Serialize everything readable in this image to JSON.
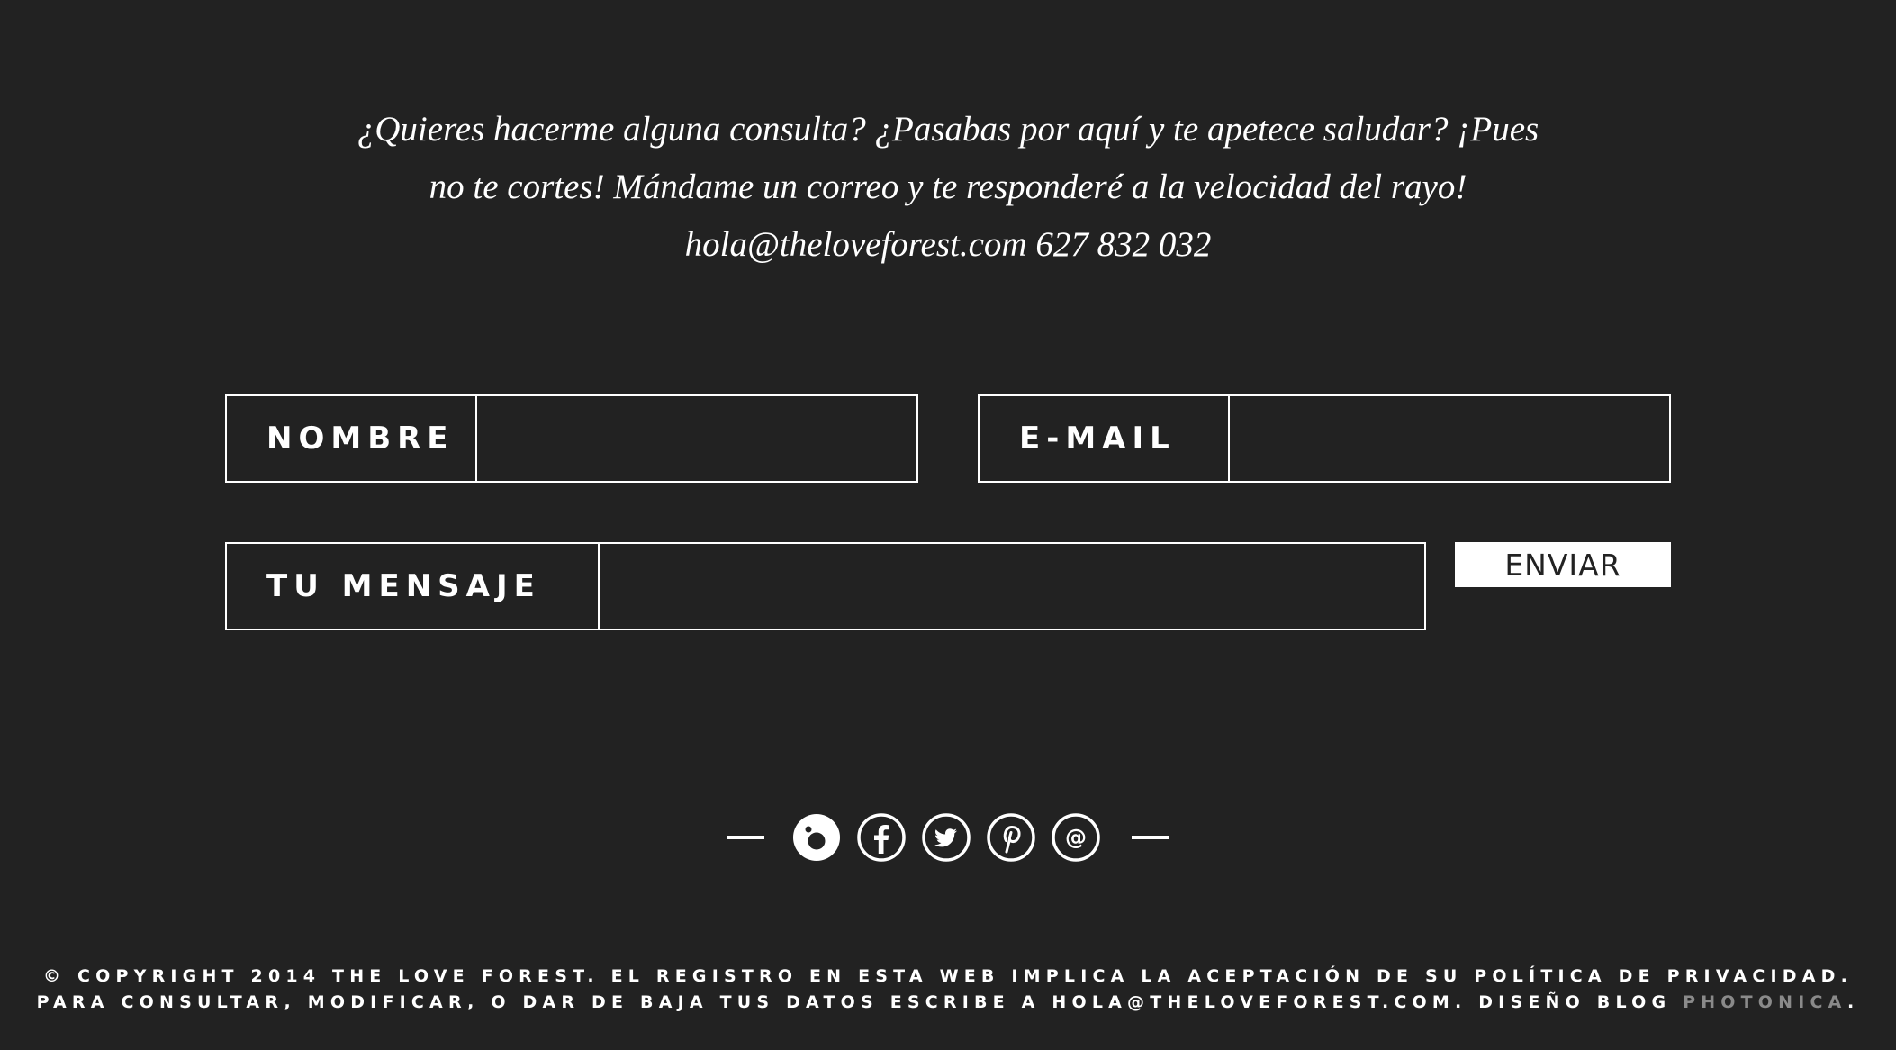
{
  "intro": {
    "line1": "¿Quieres hacerme alguna consulta? ¿Pasabas por aquí y te apetece saludar? ¡Pues",
    "line2": "no te cortes! Mándame un correo y te responderé a la velocidad del rayo!",
    "contact": "hola@theloveforest.com 627 832 032"
  },
  "form": {
    "name_label": "NOMBRE",
    "name_value": "",
    "email_label": "E-MAIL",
    "email_value": "",
    "message_label": "TU MENSAJE",
    "message_value": "",
    "submit_label": "ENVIAR"
  },
  "social": {
    "icons": [
      "bloglovin-icon",
      "facebook-icon",
      "twitter-icon",
      "pinterest-icon",
      "email-icon"
    ]
  },
  "footer": {
    "line1": "© COPYRIGHT 2014 THE LOVE FOREST. EL REGISTRO EN ESTA WEB IMPLICA LA ACEPTACIÓN DE SU POLÍTICA DE PRIVACIDAD.",
    "line2_prefix": "PARA CONSULTAR, MODIFICAR, O DAR DE BAJA TUS DATOS ESCRIBE A HOLA@THELOVEFOREST.COM. DISEÑO BLOG ",
    "credit_link": "PHOTONICA",
    "line2_suffix": "."
  },
  "colors": {
    "background": "#222222",
    "text": "#ffffff",
    "credit_link": "#8a8a8a"
  }
}
